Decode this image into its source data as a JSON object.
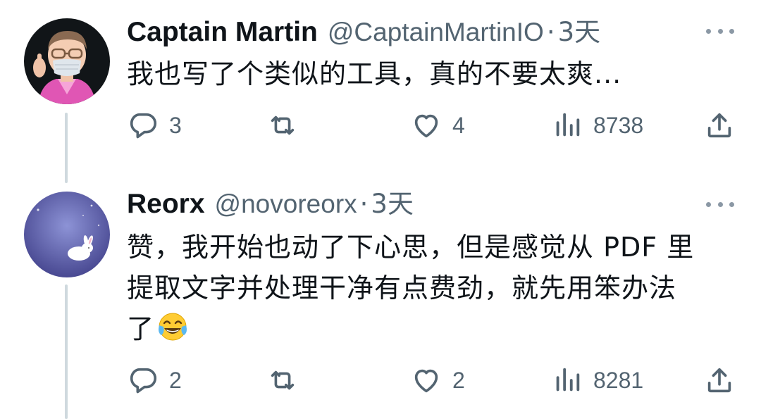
{
  "colors": {
    "text_primary": "#0f1419",
    "text_secondary": "#536471",
    "thread_line": "#cfd9de",
    "icon": "#536471"
  },
  "tweets": [
    {
      "name": "Captain Martin",
      "handle": "@CaptainMartinIO",
      "separator": "·",
      "time": "3天",
      "avatar_icon": "memoji-avatar",
      "text_lines": [
        "我也写了个类似的工具，真的不要太爽..."
      ],
      "actions": {
        "reply_count": "3",
        "retweet_count": "",
        "like_count": "4",
        "views_count": "8738"
      }
    },
    {
      "name": "Reorx",
      "handle": "@novoreorx",
      "separator": "·",
      "time": "3天",
      "avatar_icon": "moon-rabbit-avatar",
      "text_lines": [
        "赞，我开始也动了下心思，但是感觉从 PDF 里",
        "提取文字并处理干净有点费劲，就先用笨办法",
        "了"
      ],
      "emoji": "tears-of-joy-emoji",
      "actions": {
        "reply_count": "2",
        "retweet_count": "",
        "like_count": "2",
        "views_count": "8281"
      }
    }
  ]
}
